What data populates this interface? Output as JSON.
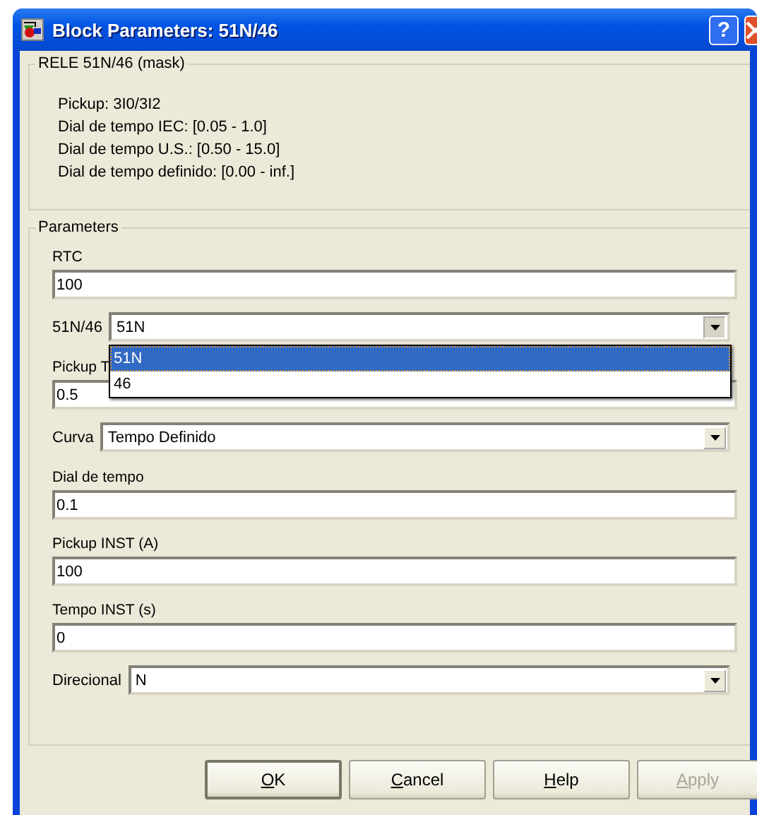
{
  "window": {
    "title": "Block Parameters: 51N/46",
    "help_button": "?"
  },
  "mask": {
    "title": "RELE 51N/46 (mask)",
    "lines": [
      "Pickup: 3I0/3I2",
      "Dial de tempo IEC: [0.05 - 1.0]",
      "Dial de tempo U.S.: [0.50 - 15.0]",
      "Dial de tempo definido: [0.00 - inf.]"
    ]
  },
  "parameters": {
    "title": "Parameters",
    "fields": [
      {
        "kind": "edit",
        "label": "RTC",
        "value": "100"
      },
      {
        "kind": "popup",
        "label": "51N/46",
        "value": "51N",
        "expanded": true,
        "options": [
          {
            "label": "51N",
            "selected": true
          },
          {
            "label": "46",
            "selected": false
          }
        ]
      },
      {
        "kind": "edit",
        "label": "Pickup T",
        "value": "0.5"
      },
      {
        "kind": "popup",
        "label": "Curva",
        "value": "Tempo Definido",
        "expanded": false
      },
      {
        "kind": "edit",
        "label": "Dial de tempo",
        "value": "0.1"
      },
      {
        "kind": "edit",
        "label": "Pickup INST (A)",
        "value": "100"
      },
      {
        "kind": "edit",
        "label": "Tempo INST (s)",
        "value": "0"
      },
      {
        "kind": "popup",
        "label": "Direcional",
        "value": "N",
        "expanded": false
      }
    ]
  },
  "buttons": [
    {
      "label": "OK",
      "disabled": false,
      "default": true
    },
    {
      "label": "Cancel",
      "disabled": false,
      "default": false
    },
    {
      "label": "Help",
      "disabled": false,
      "default": false
    },
    {
      "label": "Apply",
      "disabled": true,
      "default": false
    }
  ]
}
